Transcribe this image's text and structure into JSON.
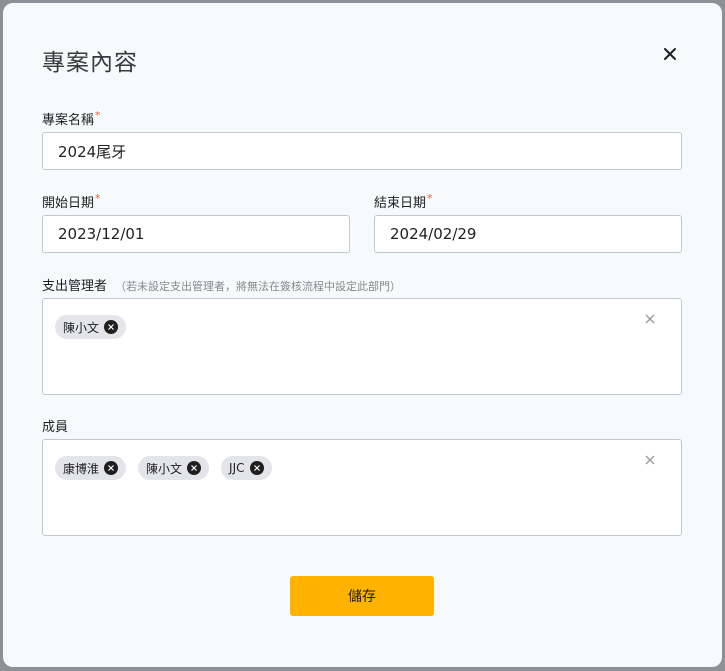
{
  "modal": {
    "title": "專案內容"
  },
  "project_name": {
    "label": "專案名稱",
    "required_mark": "*",
    "value": "2024尾牙"
  },
  "start_date": {
    "label": "開始日期",
    "required_mark": "*",
    "value": "2023/12/01"
  },
  "end_date": {
    "label": "結束日期",
    "required_mark": "*",
    "value": "2024/02/29"
  },
  "expense_manager": {
    "label": "支出管理者",
    "hint": "（若未設定支出管理者，將無法在簽核流程中設定此部門）",
    "tags": [
      "陳小文"
    ]
  },
  "members": {
    "label": "成員",
    "tags": [
      "康博淮",
      "陳小文",
      "JJC"
    ]
  },
  "save_button": {
    "label": "儲存"
  },
  "colors": {
    "accent": "#ffb300",
    "required": "#e8612b"
  }
}
